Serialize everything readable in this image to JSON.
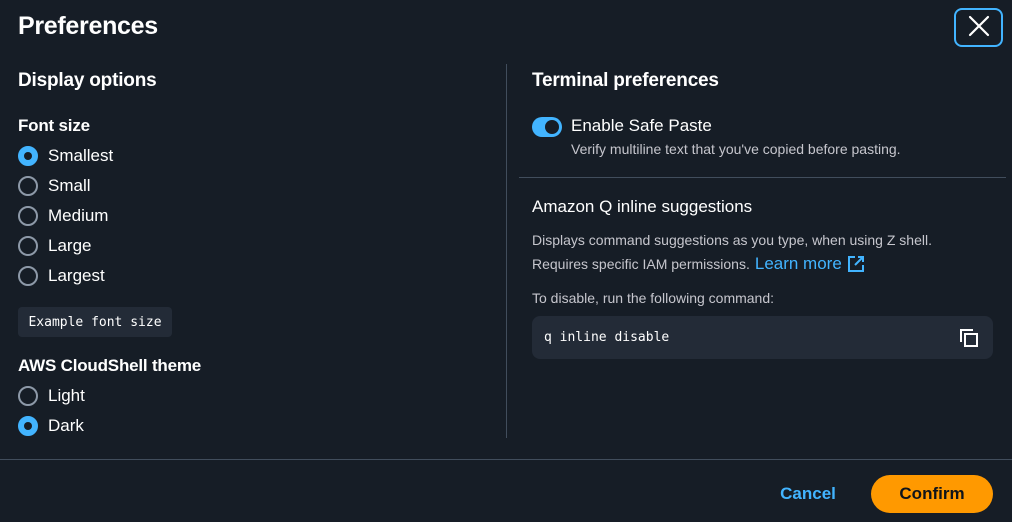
{
  "dialog": {
    "title": "Preferences"
  },
  "display_options": {
    "heading": "Display options",
    "font_size": {
      "label": "Font size",
      "options": [
        "Smallest",
        "Small",
        "Medium",
        "Large",
        "Largest"
      ],
      "selected": "Smallest"
    },
    "example_text": "Example font size",
    "theme": {
      "label": "AWS CloudShell theme",
      "options": [
        "Light",
        "Dark"
      ],
      "selected": "Dark"
    }
  },
  "terminal_preferences": {
    "heading": "Terminal preferences",
    "safe_paste": {
      "label": "Enable Safe Paste",
      "description": "Verify multiline text that you've copied before pasting.",
      "enabled": true
    },
    "amazon_q": {
      "heading": "Amazon Q inline suggestions",
      "description_line1": "Displays command suggestions as you type, when using Z shell.",
      "description_line2": "Requires specific IAM permissions.",
      "learn_more": "Learn more",
      "disable_instruction": "To disable, run the following command:",
      "command": "q inline disable"
    }
  },
  "footer": {
    "cancel_label": "Cancel",
    "confirm_label": "Confirm"
  },
  "colors": {
    "accent": "#42b4ff",
    "primary_button": "#ff9900",
    "background": "#161d26"
  },
  "icons": [
    "close-icon",
    "external-link-icon",
    "copy-icon"
  ]
}
